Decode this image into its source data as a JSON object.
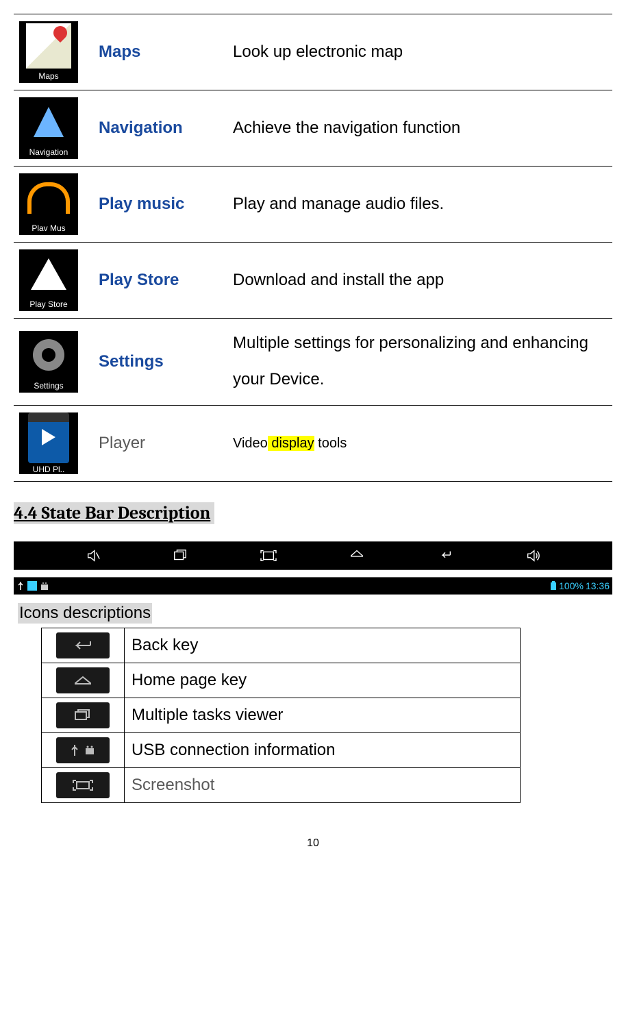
{
  "apps": [
    {
      "icon_label": "Maps",
      "name": "Maps",
      "desc": "Look up electronic map",
      "link": true
    },
    {
      "icon_label": "Navigation",
      "name": "Navigation",
      "desc": "Achieve the navigation function",
      "link": true
    },
    {
      "icon_label": "Plav Mus",
      "name": "Play music",
      "desc": "Play and manage audio files.",
      "link": true
    },
    {
      "icon_label": "Play Store",
      "name": "Play Store",
      "desc": "Download and install the app",
      "link": true
    },
    {
      "icon_label": "Settings",
      "name": "Settings",
      "desc": "Multiple settings for personalizing and enhancing your Device.",
      "link": true
    }
  ],
  "player_row": {
    "icon_label": "UHD Pl..",
    "name": "Player",
    "desc_prefix": "Video",
    "desc_highlight": " display",
    "desc_suffix": " tools"
  },
  "section_heading": "4.4 State Bar Description ",
  "status": {
    "battery": "100%",
    "time": "13:36"
  },
  "icons_desc_label": "Icons descriptions",
  "icon_rows": [
    {
      "label": "Back key"
    },
    {
      "label": "Home page key"
    },
    {
      "label": "Multiple tasks viewer"
    },
    {
      "label": "USB connection information"
    },
    {
      "label": "Screenshot"
    }
  ],
  "page_number": "10"
}
